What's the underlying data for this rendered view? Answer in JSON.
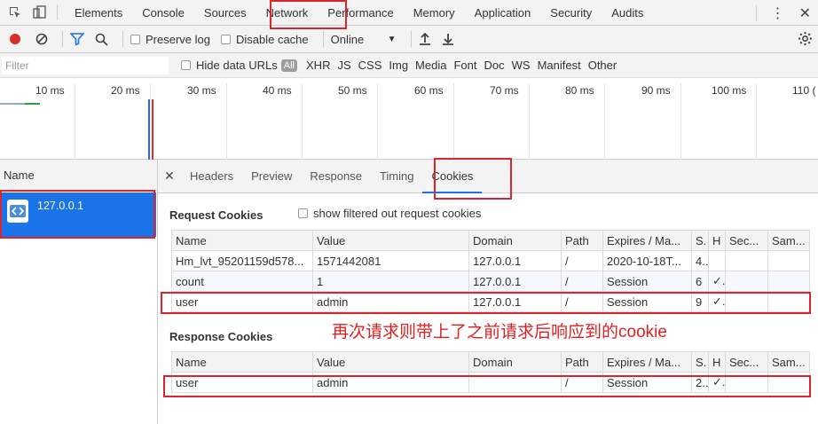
{
  "topbar": {
    "tabs": [
      "Elements",
      "Console",
      "Sources",
      "Network",
      "Performance",
      "Memory",
      "Application",
      "Security",
      "Audits"
    ],
    "active_tab": "Network"
  },
  "toolbar": {
    "preserve_log": "Preserve log",
    "disable_cache": "Disable cache",
    "throttle": "Online"
  },
  "filterbar": {
    "placeholder": "Filter",
    "hide_data_urls": "Hide data URLs",
    "types": [
      "All",
      "XHR",
      "JS",
      "CSS",
      "Img",
      "Media",
      "Font",
      "Doc",
      "WS",
      "Manifest",
      "Other"
    ]
  },
  "timeline": {
    "ticks": [
      "10 ms",
      "20 ms",
      "30 ms",
      "40 ms",
      "50 ms",
      "60 ms",
      "70 ms",
      "80 ms",
      "90 ms",
      "100 ms",
      "110 ("
    ]
  },
  "requests": {
    "header": "Name",
    "selected": "127.0.0.1"
  },
  "details": {
    "tabs": [
      "Headers",
      "Preview",
      "Response",
      "Timing",
      "Cookies"
    ],
    "active_tab": "Cookies"
  },
  "request_cookies": {
    "title": "Request Cookies",
    "show_filtered": "show filtered out request cookies",
    "columns": [
      "Name",
      "Value",
      "Domain",
      "Path",
      "Expires / Ma...",
      "S.",
      "H",
      "Sec...",
      "Sam..."
    ],
    "rows": [
      [
        "Hm_lvt_95201159d578...",
        "1571442081",
        "127.0.0.1",
        "/",
        "2020-10-18T...",
        "4..",
        "",
        "",
        ""
      ],
      [
        "count",
        "1",
        "127.0.0.1",
        "/",
        "Session",
        "6",
        "✓.",
        "",
        ""
      ],
      [
        "user",
        "admin",
        "127.0.0.1",
        "/",
        "Session",
        "9",
        "✓.",
        "",
        ""
      ]
    ]
  },
  "response_cookies": {
    "title": "Response Cookies",
    "columns": [
      "Name",
      "Value",
      "Domain",
      "Path",
      "Expires / Ma...",
      "S.",
      "H",
      "Sec...",
      "Sam..."
    ],
    "rows": [
      [
        "user",
        "admin",
        "",
        "/",
        "Session",
        "2..",
        "✓.",
        "",
        ""
      ]
    ]
  },
  "annotation": "再次请求则带上了之前请求后响应到的cookie",
  "colors": {
    "accent": "#1a73e8",
    "annotation": "#d9262c",
    "record": "#d93025"
  }
}
